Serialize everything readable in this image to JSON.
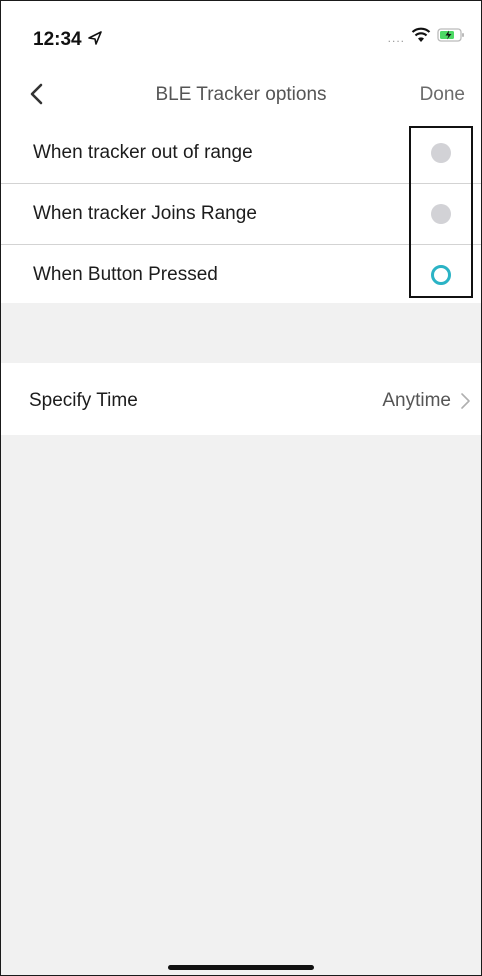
{
  "status_bar": {
    "time": "12:34",
    "signal": "....",
    "icons": [
      "location-arrow-icon",
      "wifi-icon",
      "battery-charging-icon"
    ]
  },
  "nav": {
    "back_icon": "chevron-left-icon",
    "title": "BLE Tracker options",
    "done_label": "Done"
  },
  "options": [
    {
      "label": "When tracker out of range",
      "selected": false
    },
    {
      "label": "When tracker Joins Range",
      "selected": false
    },
    {
      "label": "When Button Pressed",
      "selected": true
    }
  ],
  "specify_time": {
    "label": "Specify Time",
    "value": "Anytime",
    "icon": "chevron-right-icon"
  },
  "colors": {
    "selected_ring": "#2bb3c5",
    "unselected_radio": "#d2d2d6",
    "background": "#f1f1f1",
    "battery_green": "#4cd964"
  }
}
